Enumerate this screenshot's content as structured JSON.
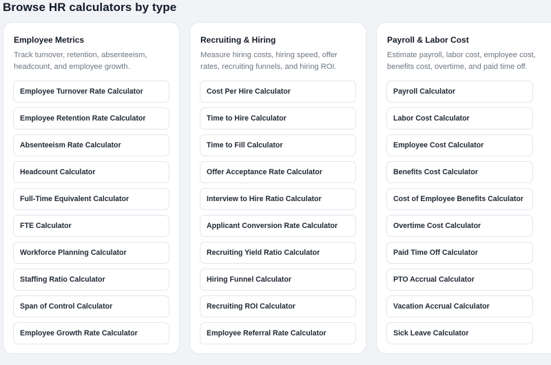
{
  "page": {
    "title": "Browse HR calculators by type"
  },
  "categories": [
    {
      "title": "Employee Metrics",
      "description": "Track turnover, retention, absenteeism, headcount, and employee growth.",
      "items": [
        "Employee Turnover Rate Calculator",
        "Employee Retention Rate Calculator",
        "Absenteeism Rate Calculator",
        "Headcount Calculator",
        "Full-Time Equivalent Calculator",
        "FTE Calculator",
        "Workforce Planning Calculator",
        "Staffing Ratio Calculator",
        "Span of Control Calculator",
        "Employee Growth Rate Calculator"
      ]
    },
    {
      "title": "Recruiting & Hiring",
      "description": "Measure hiring costs, hiring speed, offer rates, recruiting funnels, and hiring ROI.",
      "items": [
        "Cost Per Hire Calculator",
        "Time to Hire Calculator",
        "Time to Fill Calculator",
        "Offer Acceptance Rate Calculator",
        "Interview to Hire Ratio Calculator",
        "Applicant Conversion Rate Calculator",
        "Recruiting Yield Ratio Calculator",
        "Hiring Funnel Calculator",
        "Recruiting ROI Calculator",
        "Employee Referral Rate Calculator"
      ]
    },
    {
      "title": "Payroll & Labor Cost",
      "description": "Estimate payroll, labor cost, employee cost, benefits cost, overtime, and paid time off.",
      "items": [
        "Payroll Calculator",
        "Labor Cost Calculator",
        "Employee Cost Calculator",
        "Benefits Cost Calculator",
        "Cost of Employee Benefits Calculator",
        "Overtime Cost Calculator",
        "Paid Time Off Calculator",
        "PTO Accrual Calculator",
        "Vacation Accrual Calculator",
        "Sick Leave Calculator"
      ]
    }
  ]
}
